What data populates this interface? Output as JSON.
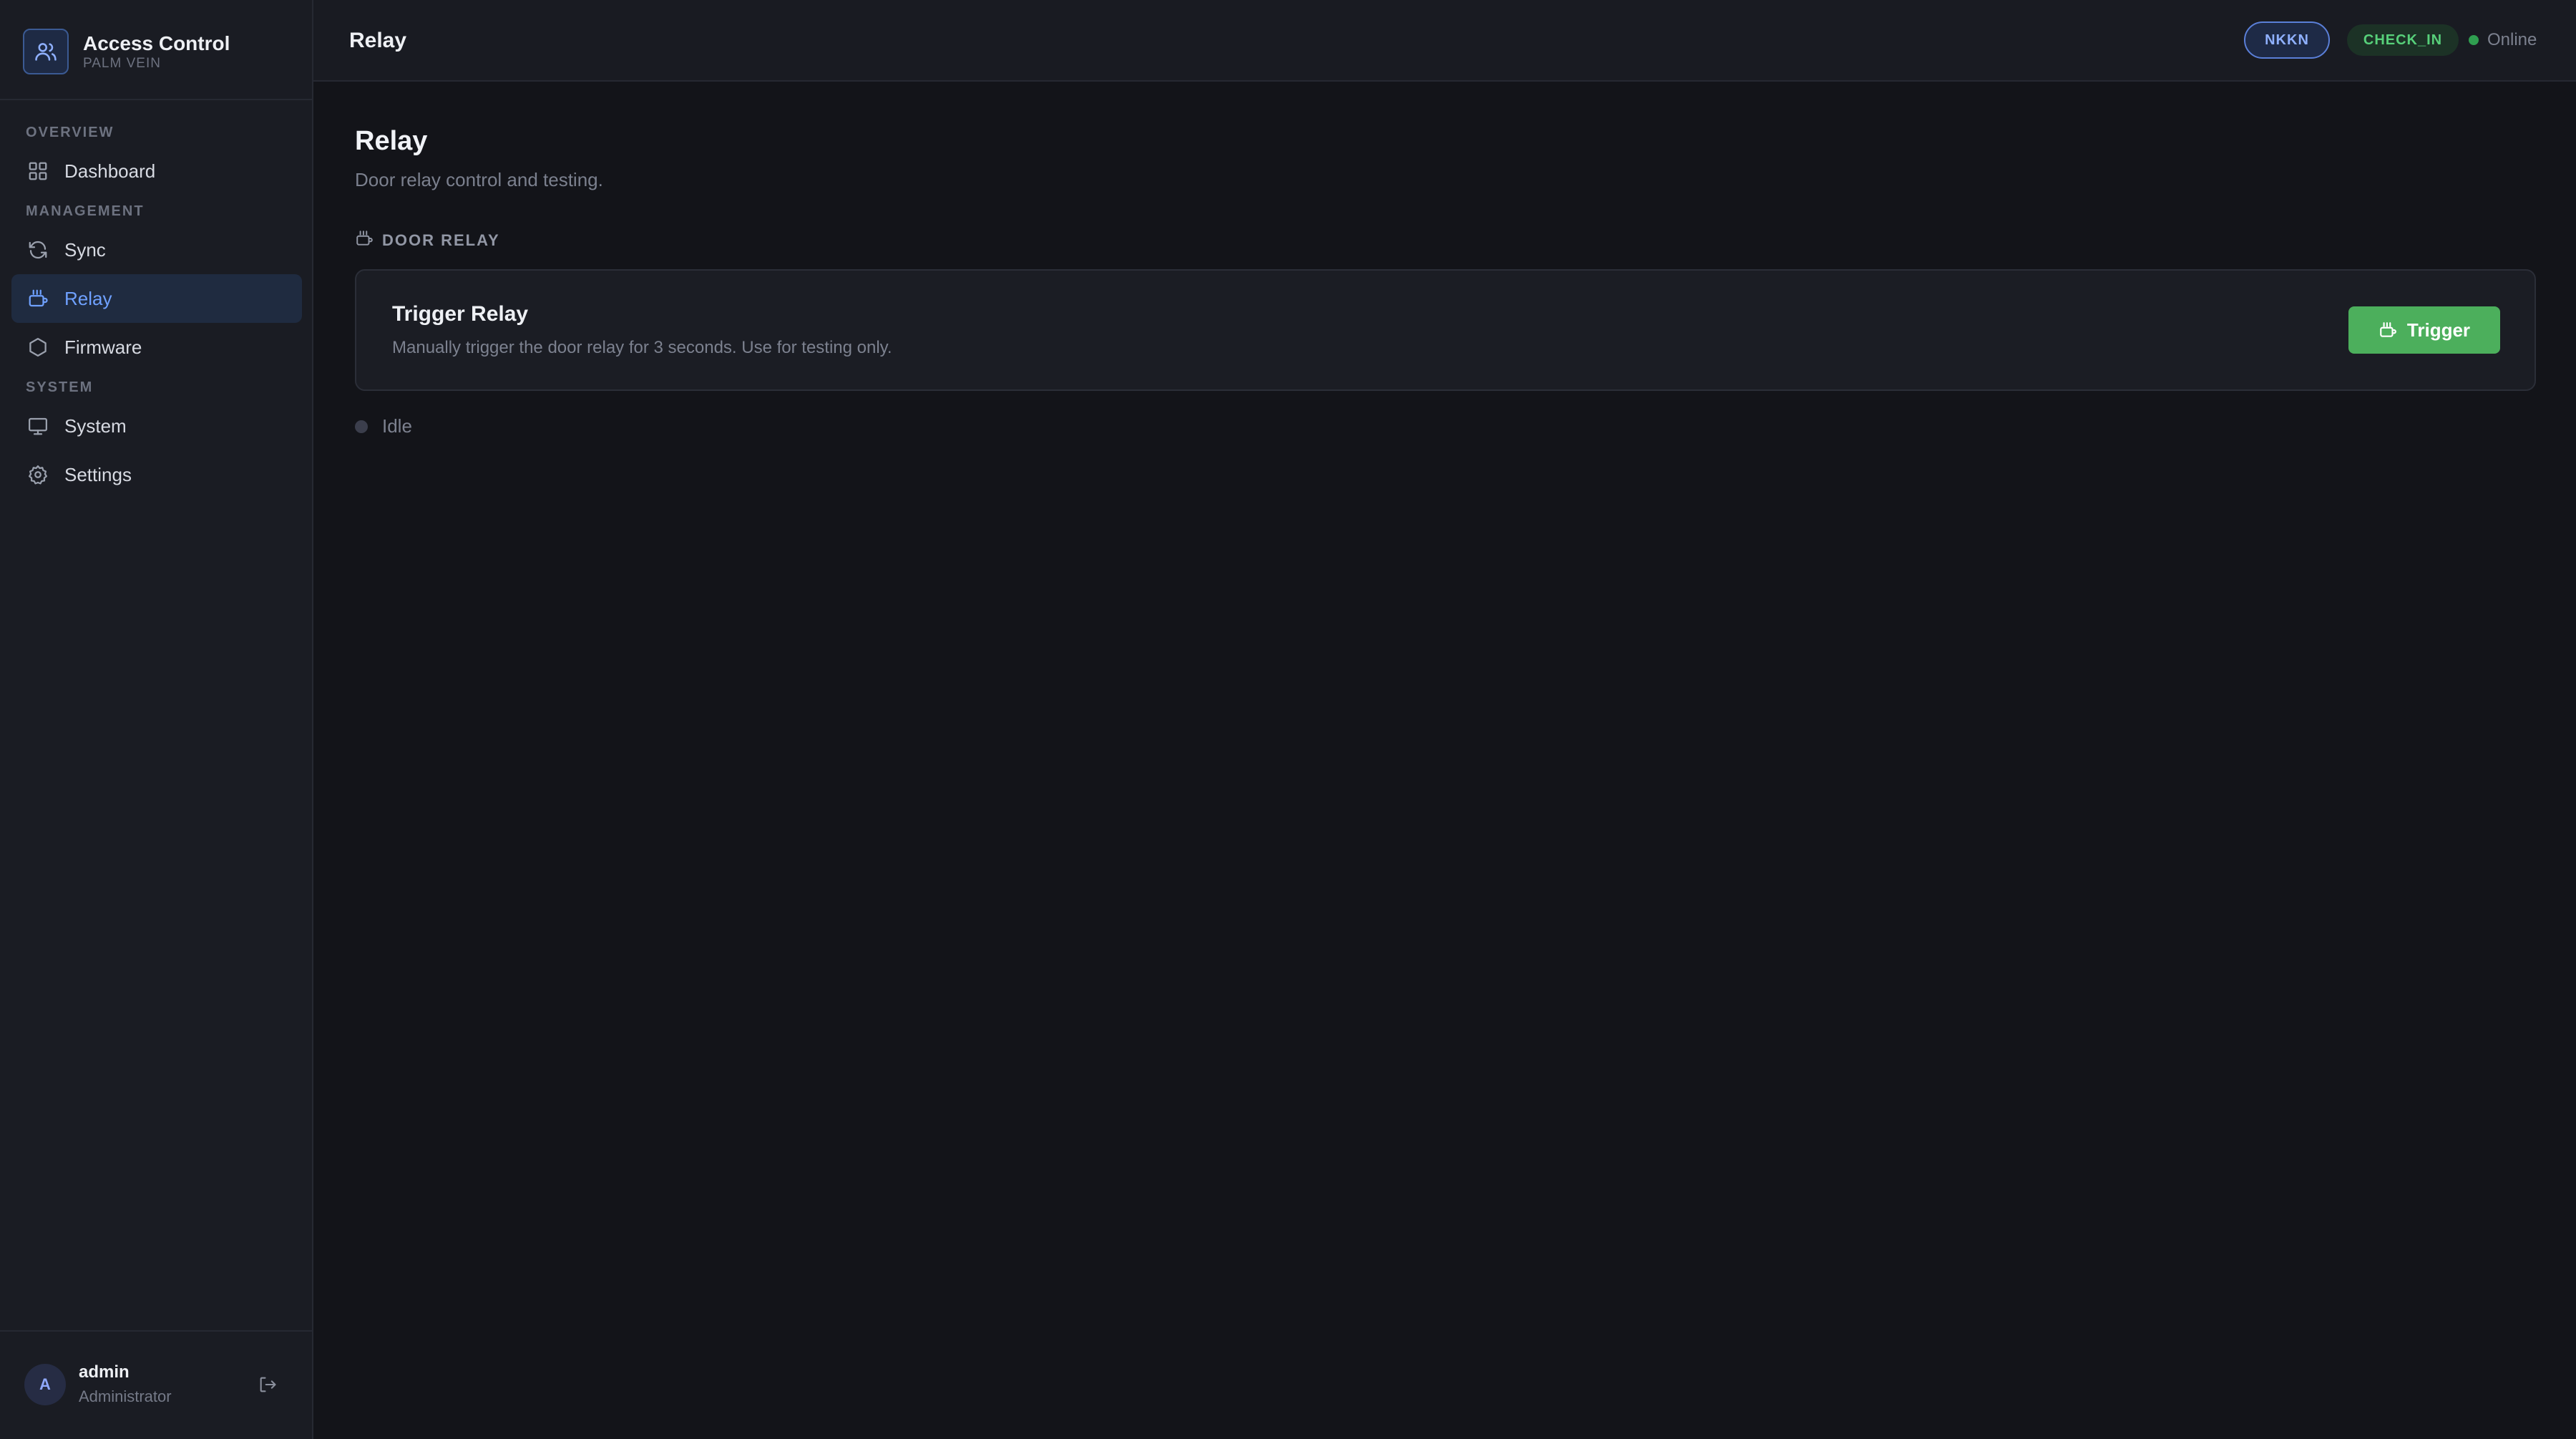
{
  "app": {
    "title": "Access Control",
    "subtitle": "PALM VEIN"
  },
  "sidebar": {
    "sections": [
      {
        "label": "OVERVIEW"
      },
      {
        "label": "MANAGEMENT"
      },
      {
        "label": "SYSTEM"
      }
    ],
    "items": [
      {
        "label": "Dashboard",
        "icon": "grid-icon",
        "active": false
      },
      {
        "label": "Sync",
        "icon": "refresh-icon",
        "active": false
      },
      {
        "label": "Relay",
        "icon": "relay-icon",
        "active": true
      },
      {
        "label": "Firmware",
        "icon": "hexagon-icon",
        "active": false
      },
      {
        "label": "System",
        "icon": "monitor-icon",
        "active": false
      },
      {
        "label": "Settings",
        "icon": "gear-icon",
        "active": false
      }
    ]
  },
  "user": {
    "initial": "A",
    "name": "admin",
    "role": "Administrator"
  },
  "header": {
    "title": "Relay",
    "device_badge": "NKKN",
    "mode_badge": "CHECK_IN",
    "status": "Online"
  },
  "main": {
    "title": "Relay",
    "subtitle": "Door relay control and testing.",
    "section_label": "DOOR RELAY",
    "card": {
      "title": "Trigger Relay",
      "description": "Manually trigger the door relay for 3 seconds. Use for testing only.",
      "button_label": "Trigger"
    },
    "relay_status": "Idle"
  },
  "colors": {
    "accent": "#6fa1ff",
    "success": "#4caf5c",
    "online": "#2f9e50",
    "background": "#131419",
    "sidebar": "#1a1c23"
  }
}
